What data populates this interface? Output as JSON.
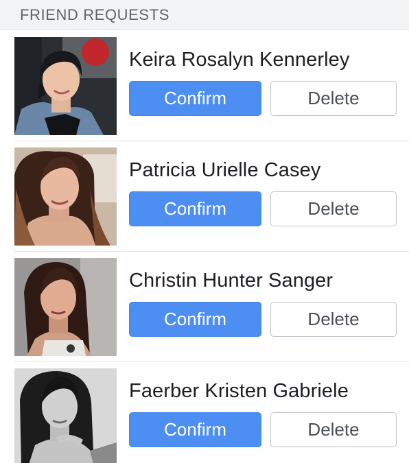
{
  "header": {
    "title": "FRIEND REQUESTS"
  },
  "requests": [
    {
      "name": "Keira Rosalyn Kennerley",
      "confirm_label": "Confirm",
      "delete_label": "Delete"
    },
    {
      "name": "Patricia Urielle Casey",
      "confirm_label": "Confirm",
      "delete_label": "Delete"
    },
    {
      "name": "Christin Hunter Sanger",
      "confirm_label": "Confirm",
      "delete_label": "Delete"
    },
    {
      "name": "Faerber Kristen Gabriele",
      "confirm_label": "Confirm",
      "delete_label": "Delete"
    }
  ],
  "colors": {
    "confirm_button": "#4d8ef2",
    "header_background": "#f2f3f5",
    "delete_border": "#bfc3c9"
  }
}
